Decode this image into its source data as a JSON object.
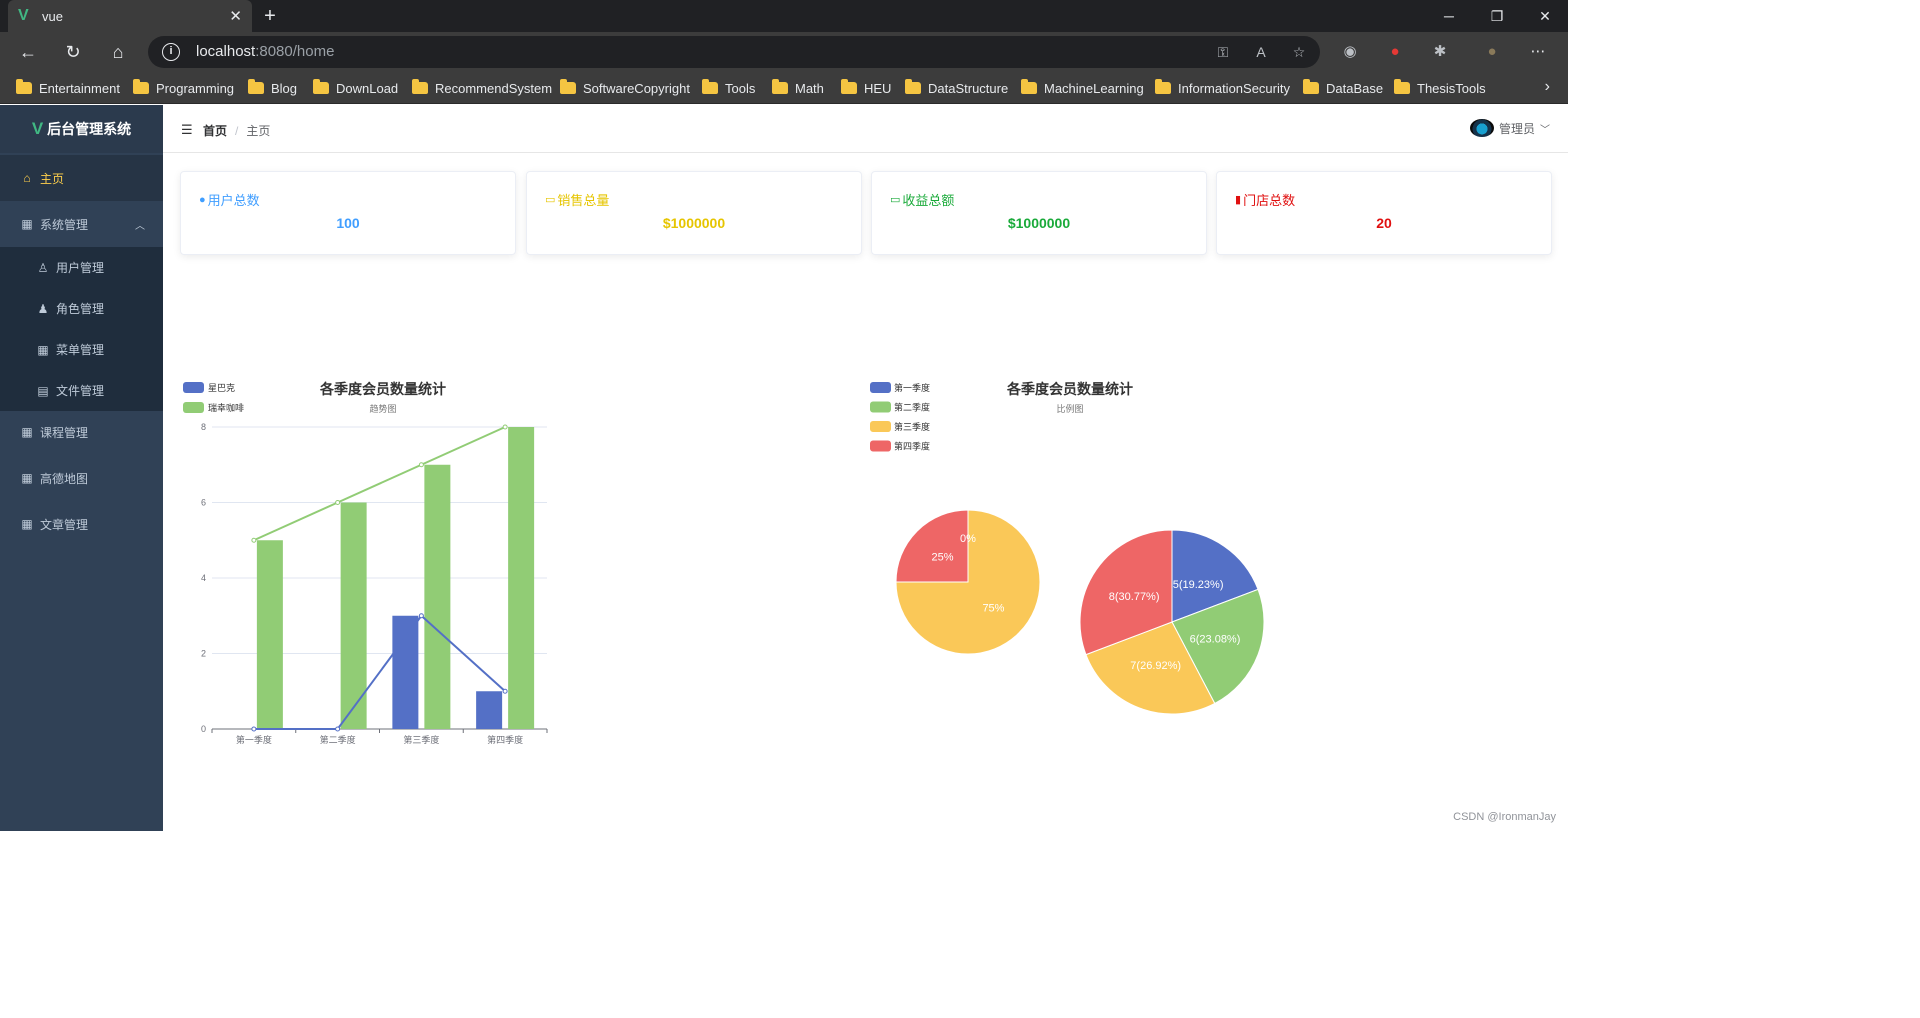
{
  "browser": {
    "tab_title": "vue",
    "url_host": "localhost",
    "url_rest": ":8080/home",
    "bookmarks": [
      "Entertainment",
      "Programming",
      "Blog",
      "DownLoad",
      "RecommendSystem",
      "SoftwareCopyright",
      "Tools",
      "Math",
      "HEU",
      "DataStructure",
      "MachineLearning",
      "InformationSecurity",
      "DataBase",
      "ThesisTools"
    ]
  },
  "sidebar": {
    "brand": "后台管理系统",
    "items": [
      {
        "label": "主页",
        "icon": "home-icon"
      },
      {
        "label": "系统管理",
        "icon": "grid-icon"
      },
      {
        "label": "用户管理",
        "icon": "user-icon"
      },
      {
        "label": "角色管理",
        "icon": "user-solid-icon"
      },
      {
        "label": "菜单管理",
        "icon": "menu-icon"
      },
      {
        "label": "文件管理",
        "icon": "document-icon"
      },
      {
        "label": "课程管理",
        "icon": "menu-icon"
      },
      {
        "label": "高德地图",
        "icon": "grid-icon"
      },
      {
        "label": "文章管理",
        "icon": "menu-icon"
      }
    ]
  },
  "header": {
    "breadcrumb_home": "首页",
    "breadcrumb_current": "主页",
    "user_name": "管理员"
  },
  "cards": [
    {
      "title": "用户总数",
      "value": "100",
      "color": "#409eff"
    },
    {
      "title": "销售总量",
      "value": "$1000000",
      "color": "#e6c500"
    },
    {
      "title": "收益总额",
      "value": "$1000000",
      "color": "#1aaa3a"
    },
    {
      "title": "门店总数",
      "value": "20",
      "color": "#e01010"
    }
  ],
  "chart_data": [
    {
      "type": "bar",
      "title": "各季度会员数量统计",
      "subtitle": "趋势图",
      "categories": [
        "第一季度",
        "第二季度",
        "第三季度",
        "第四季度"
      ],
      "ylim": [
        0,
        8
      ],
      "yticks": [
        0,
        2,
        4,
        6,
        8
      ],
      "legend": "top-left",
      "series": [
        {
          "name": "星巴克",
          "color": "#5470c6",
          "values": [
            0,
            0,
            3,
            1
          ]
        },
        {
          "name": "瑞幸咖啡",
          "color": "#91cc75",
          "values": [
            5,
            6,
            7,
            8
          ]
        }
      ],
      "line_overlay": true
    },
    {
      "type": "pie",
      "title": "各季度会员数量统计",
      "subtitle": "比例图",
      "legend": "top-left",
      "legend_labels": [
        "第一季度",
        "第二季度",
        "第三季度",
        "第四季度"
      ],
      "colors": [
        "#5470c6",
        "#91cc75",
        "#fac858",
        "#ee6666"
      ],
      "pies": [
        {
          "values": [
            0,
            0,
            3,
            1
          ],
          "labels": [
            "0%",
            "0%",
            "75%",
            "25%"
          ]
        },
        {
          "values": [
            5,
            6,
            7,
            8
          ],
          "labels": [
            "5(19.23%)",
            "6(23.08%)",
            "7(26.92%)",
            "8(30.77%)"
          ]
        }
      ]
    }
  ],
  "watermark": "CSDN @IronmanJay"
}
